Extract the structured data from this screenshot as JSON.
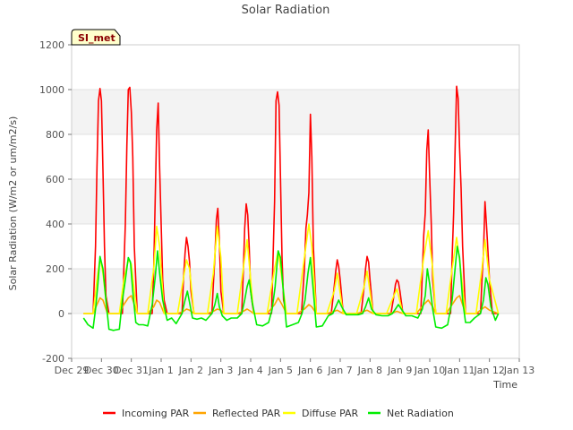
{
  "chart_data": {
    "type": "line",
    "title": "Solar Radiation",
    "xlabel": "Time",
    "ylabel": "Solar Radiation (W/m2 or um/m2/s)",
    "ylim": [
      -200,
      1200
    ],
    "yticks": [
      -200,
      0,
      200,
      400,
      600,
      800,
      1000,
      1200
    ],
    "xlim": [
      0,
      15
    ],
    "x_unit": "days from Dec 29",
    "xtick_labels": [
      "Dec 29",
      "Dec 30",
      "Dec 31",
      "Jan 1",
      "Jan 2",
      "Jan 3",
      "Jan 4",
      "Jan 5",
      "Jan 6",
      "Jan 7",
      "Jan 8",
      "Jan 9",
      "Jan 10",
      "Jan 11",
      "Jan 12",
      "Jan 13"
    ],
    "grid": true,
    "legend_position": "bottom",
    "site_badge": "SI_met",
    "series": [
      {
        "name": "Incoming PAR",
        "color": "#ff0000",
        "x": [
          0.4,
          0.72,
          0.8,
          0.85,
          0.9,
          0.95,
          1.0,
          1.05,
          1.1,
          1.15,
          1.25,
          1.6,
          1.7,
          1.8,
          1.85,
          1.9,
          1.95,
          2.0,
          2.05,
          2.1,
          2.2,
          2.55,
          2.7,
          2.75,
          2.8,
          2.85,
          2.9,
          2.95,
          3.0,
          3.05,
          3.1,
          3.2,
          3.55,
          3.7,
          3.75,
          3.8,
          3.85,
          3.9,
          3.95,
          4.0,
          4.1,
          4.55,
          4.7,
          4.75,
          4.8,
          4.85,
          4.9,
          4.95,
          5.0,
          5.1,
          5.55,
          5.7,
          5.75,
          5.8,
          5.85,
          5.9,
          5.95,
          6.0,
          6.1,
          6.55,
          6.7,
          6.8,
          6.85,
          6.9,
          6.95,
          7.0,
          7.05,
          7.1,
          7.2,
          7.55,
          7.7,
          7.8,
          7.85,
          7.9,
          7.95,
          8.0,
          8.05,
          8.1,
          8.2,
          8.55,
          8.7,
          8.8,
          8.85,
          8.9,
          8.95,
          9.0,
          9.1,
          9.55,
          9.7,
          9.8,
          9.85,
          9.9,
          9.95,
          10.0,
          10.1,
          10.55,
          10.7,
          10.8,
          10.85,
          10.9,
          10.95,
          11.0,
          11.1,
          11.55,
          11.7,
          11.8,
          11.85,
          11.9,
          11.95,
          12.0,
          12.05,
          12.1,
          12.2,
          12.55,
          12.7,
          12.75,
          12.8,
          12.85,
          12.9,
          12.95,
          13.0,
          13.05,
          13.1,
          13.2,
          13.55,
          13.7,
          13.75,
          13.8,
          13.85,
          13.9,
          13.95,
          14.0,
          14.1,
          14.3
        ],
        "y": [
          0,
          0,
          300,
          650,
          950,
          1005,
          950,
          640,
          300,
          80,
          0,
          0,
          0,
          400,
          750,
          1000,
          1010,
          900,
          700,
          300,
          0,
          0,
          0,
          200,
          500,
          820,
          940,
          650,
          400,
          150,
          60,
          0,
          0,
          0,
          160,
          270,
          340,
          300,
          230,
          100,
          0,
          0,
          0,
          130,
          250,
          420,
          470,
          320,
          100,
          0,
          0,
          0,
          180,
          380,
          490,
          440,
          300,
          100,
          0,
          0,
          0,
          500,
          950,
          990,
          930,
          600,
          250,
          60,
          0,
          0,
          0,
          200,
          380,
          440,
          540,
          890,
          700,
          300,
          0,
          0,
          0,
          120,
          190,
          240,
          210,
          150,
          0,
          0,
          0,
          120,
          200,
          255,
          230,
          150,
          0,
          0,
          0,
          80,
          130,
          150,
          140,
          100,
          0,
          0,
          0,
          350,
          450,
          730,
          820,
          600,
          400,
          150,
          0,
          0,
          0,
          250,
          450,
          730,
          1015,
          960,
          740,
          560,
          300,
          0,
          0,
          0,
          150,
          270,
          500,
          400,
          280,
          150,
          0,
          0
        ]
      },
      {
        "name": "Reflected PAR",
        "color": "#ffa500",
        "x": [
          0.4,
          0.72,
          0.85,
          0.95,
          1.05,
          1.2,
          1.6,
          1.75,
          1.9,
          2.0,
          2.1,
          2.2,
          2.55,
          2.75,
          2.85,
          2.95,
          3.1,
          3.55,
          3.75,
          3.85,
          3.95,
          4.1,
          4.55,
          4.75,
          4.88,
          5.0,
          5.1,
          5.55,
          5.75,
          5.88,
          6.0,
          6.1,
          6.55,
          6.8,
          6.92,
          7.05,
          7.2,
          7.55,
          7.8,
          7.95,
          8.05,
          8.2,
          8.55,
          8.8,
          8.9,
          9.1,
          9.55,
          9.8,
          9.9,
          10.1,
          10.55,
          10.8,
          10.9,
          11.1,
          11.55,
          11.8,
          11.95,
          12.1,
          12.2,
          12.55,
          12.75,
          12.9,
          13.0,
          13.2,
          13.55,
          13.75,
          13.85,
          14.0,
          14.3
        ],
        "y": [
          0,
          0,
          40,
          70,
          60,
          0,
          0,
          40,
          70,
          80,
          40,
          0,
          0,
          30,
          60,
          50,
          0,
          0,
          10,
          20,
          15,
          0,
          0,
          10,
          20,
          15,
          0,
          0,
          10,
          20,
          10,
          0,
          0,
          40,
          70,
          40,
          0,
          0,
          20,
          40,
          30,
          0,
          0,
          10,
          15,
          0,
          0,
          10,
          15,
          0,
          0,
          5,
          10,
          0,
          0,
          40,
          60,
          30,
          0,
          0,
          40,
          70,
          80,
          0,
          0,
          20,
          30,
          15,
          0
        ]
      },
      {
        "name": "Diffuse PAR",
        "color": "#ffff00",
        "x": [
          0.4,
          0.72,
          0.85,
          0.95,
          1.05,
          1.2,
          1.6,
          1.75,
          1.9,
          2.0,
          2.1,
          2.2,
          2.55,
          2.75,
          2.85,
          2.95,
          3.1,
          3.55,
          3.75,
          3.85,
          3.95,
          4.1,
          4.55,
          4.75,
          4.88,
          5.0,
          5.1,
          5.55,
          5.75,
          5.88,
          6.0,
          6.1,
          6.55,
          6.8,
          6.92,
          7.05,
          7.2,
          7.55,
          7.8,
          7.95,
          8.05,
          8.2,
          8.55,
          8.8,
          8.9,
          9.1,
          9.55,
          9.8,
          9.9,
          10.1,
          10.55,
          10.8,
          10.9,
          11.1,
          11.55,
          11.8,
          11.95,
          12.1,
          12.2,
          12.55,
          12.75,
          12.9,
          13.0,
          13.2,
          13.55,
          13.75,
          13.85,
          14.0,
          14.3
        ],
        "y": [
          0,
          0,
          150,
          250,
          180,
          0,
          0,
          150,
          240,
          220,
          100,
          0,
          0,
          200,
          390,
          300,
          0,
          0,
          160,
          240,
          200,
          0,
          0,
          180,
          390,
          250,
          0,
          0,
          200,
          330,
          150,
          0,
          0,
          200,
          280,
          150,
          0,
          0,
          250,
          400,
          300,
          0,
          0,
          100,
          180,
          0,
          0,
          120,
          190,
          0,
          0,
          80,
          110,
          0,
          0,
          250,
          370,
          200,
          0,
          0,
          200,
          340,
          240,
          0,
          0,
          200,
          330,
          150,
          0
        ]
      },
      {
        "name": "Net Radiation",
        "color": "#00ee00",
        "x": [
          0.4,
          0.55,
          0.72,
          0.8,
          0.88,
          0.95,
          1.05,
          1.15,
          1.25,
          1.4,
          1.6,
          1.7,
          1.8,
          1.9,
          1.97,
          2.05,
          2.15,
          2.25,
          2.4,
          2.55,
          2.7,
          2.8,
          2.88,
          2.95,
          3.05,
          3.2,
          3.35,
          3.5,
          3.7,
          3.8,
          3.88,
          3.95,
          4.05,
          4.2,
          4.35,
          4.5,
          4.7,
          4.8,
          4.88,
          4.95,
          5.05,
          5.2,
          5.35,
          5.55,
          5.7,
          5.8,
          5.88,
          5.95,
          6.05,
          6.2,
          6.4,
          6.6,
          6.72,
          6.82,
          6.92,
          7.0,
          7.1,
          7.2,
          7.4,
          7.6,
          7.72,
          7.82,
          7.92,
          8.0,
          8.1,
          8.2,
          8.4,
          8.6,
          8.75,
          8.85,
          8.95,
          9.05,
          9.2,
          9.4,
          9.6,
          9.75,
          9.85,
          9.95,
          10.05,
          10.2,
          10.4,
          10.6,
          10.75,
          10.85,
          10.95,
          11.05,
          11.2,
          11.4,
          11.6,
          11.75,
          11.85,
          11.92,
          12.0,
          12.1,
          12.2,
          12.4,
          12.6,
          12.75,
          12.85,
          12.92,
          13.0,
          13.1,
          13.2,
          13.35,
          13.5,
          13.7,
          13.8,
          13.88,
          13.95,
          14.05,
          14.2,
          14.3
        ],
        "y": [
          -20,
          -50,
          -65,
          20,
          130,
          255,
          200,
          60,
          -70,
          -75,
          -70,
          60,
          150,
          250,
          230,
          100,
          -40,
          -50,
          -50,
          -55,
          40,
          160,
          280,
          180,
          60,
          -30,
          -20,
          -45,
          0,
          60,
          100,
          50,
          -20,
          -25,
          -20,
          -30,
          0,
          40,
          90,
          30,
          -10,
          -30,
          -20,
          -20,
          0,
          60,
          120,
          150,
          50,
          -50,
          -55,
          -40,
          20,
          120,
          280,
          250,
          90,
          -60,
          -50,
          -40,
          0,
          60,
          180,
          250,
          100,
          -60,
          -55,
          -10,
          0,
          30,
          60,
          30,
          -5,
          -5,
          -5,
          0,
          30,
          70,
          20,
          -5,
          -10,
          -10,
          0,
          20,
          40,
          20,
          -10,
          -10,
          -20,
          20,
          80,
          200,
          130,
          20,
          -60,
          -65,
          -50,
          60,
          200,
          300,
          250,
          60,
          -40,
          -40,
          -20,
          0,
          60,
          160,
          130,
          30,
          -30,
          0
        ]
      }
    ]
  }
}
